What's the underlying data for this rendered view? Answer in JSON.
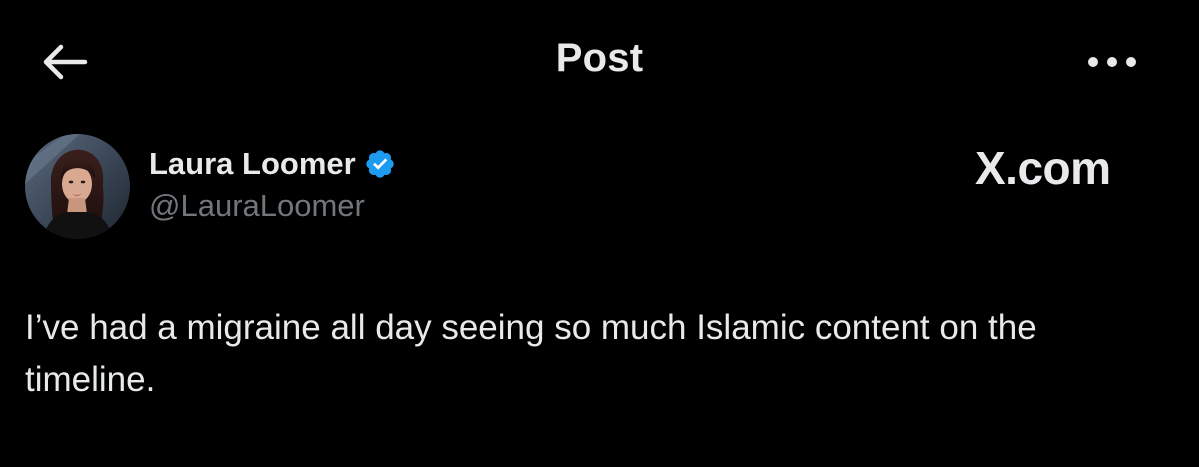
{
  "header": {
    "title": "Post",
    "back_icon": "arrow-left-icon",
    "more_icon": "more-horizontal-icon"
  },
  "author": {
    "display_name": "Laura Loomer",
    "handle": "@LauraLoomer",
    "verified": true,
    "verified_badge_color": "#1d9bf0"
  },
  "watermark": {
    "text": "X.com"
  },
  "post": {
    "text": "I’ve had a migraine all day seeing so much Islamic content on the timeline."
  },
  "colors": {
    "background": "#000000",
    "primary_text": "#e7e9ea",
    "secondary_text": "#71767b",
    "accent": "#1d9bf0"
  }
}
